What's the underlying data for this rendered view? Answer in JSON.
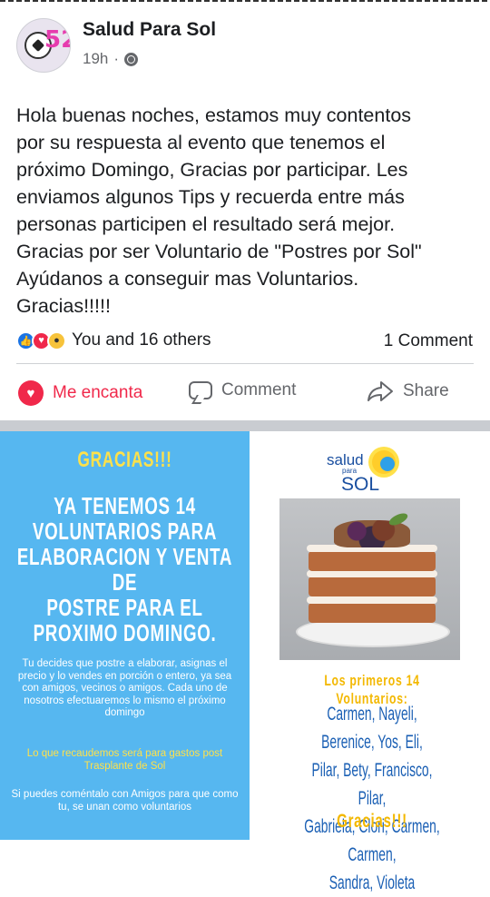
{
  "post": {
    "page_name": "Salud Para Sol",
    "time": "19h",
    "separator": "·",
    "avatar_text": "52",
    "text_lines": [
      "Hola buenas noches, estamos muy contentos",
      "por su respuesta al evento que tenemos el",
      "próximo Domingo, Gracias por participar. Les",
      "enviamos algunos Tips y recuerda entre más",
      "personas participen el resultado será mejor.",
      "Gracias por ser Voluntario de \"Postres por Sol\"",
      "Ayúdanos a conseguir mas Voluntarios.",
      "Gracias!!!!!"
    ]
  },
  "reactions": {
    "icons": [
      "like-icon",
      "love-icon",
      "wow-icon"
    ],
    "summary": "You and 16 others",
    "comments": "1 Comment"
  },
  "actions": {
    "love_label": "Me encanta",
    "comment_label": "Comment",
    "share_label": "Share"
  },
  "image": {
    "left": {
      "title": "GRACIAS!!!",
      "headline_lines": [
        "YA TENEMOS 14",
        "VOLUNTARIOS PARA",
        "ELABORACION Y VENTA DE",
        "POSTRE PARA EL",
        "PROXIMO DOMINGO."
      ],
      "para1": "Tu decides que postre a elaborar, asignas el precio y lo vendes en porción o entero, ya sea con amigos, vecinos o amigos. Cada uno de nosotros efectuaremos lo mismo el próximo  domingo",
      "para2": "Lo que recaudemos será para gastos post Trasplante de Sol",
      "para3": "Si puedes coméntalo con Amigos para que como tu, se unan como voluntarios"
    },
    "logo": {
      "word1": "salud",
      "word2": "para",
      "word3": "SOL"
    },
    "right": {
      "volunteers_title": "Los primeros 14 Voluntarios:",
      "name_lines": [
        "Carmen, Nayeli, Berenice, Yos, Eli,",
        "Pilar, Bety, Francisco, Pilar,",
        "Gabriela, Clori, Carmen, Carmen,",
        "Sandra, Violeta"
      ],
      "closing": "Gracias!!!"
    },
    "colors": {
      "panel_blue": "#56b7f0",
      "yellow": "#ffe14a",
      "names_blue": "#1a5fb4",
      "facebook_love_red": "#f0284a"
    }
  }
}
